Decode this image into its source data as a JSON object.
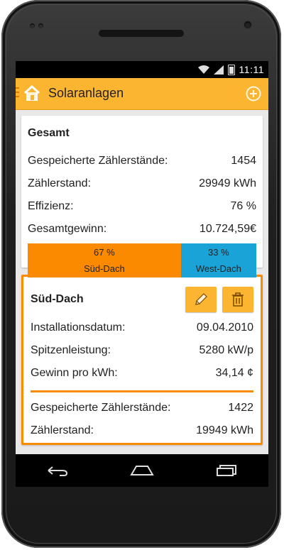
{
  "status": {
    "time": "11:11"
  },
  "app": {
    "title": "Solaranlagen"
  },
  "gesamt": {
    "title": "Gesamt",
    "rows": [
      {
        "label": "Gespeicherte Zählerstände:",
        "value": "1454"
      },
      {
        "label": "Zählerstand:",
        "value": "29949 kWh"
      },
      {
        "label": "Effizienz:",
        "value": "76 %"
      },
      {
        "label": "Gesamtgewinn:",
        "value": "10.724,59€"
      }
    ],
    "distribution": [
      {
        "percent": "67 %",
        "name": "Süd-Dach",
        "color": "#fb8a00",
        "fraction": 0.67
      },
      {
        "percent": "33 %",
        "name": "West-Dach",
        "color": "#1aa3d6",
        "fraction": 0.33
      }
    ]
  },
  "sued": {
    "title": "Süd-Dach",
    "edit_icon": "pencil-icon",
    "delete_icon": "trash-icon",
    "rows": [
      {
        "label": "Installationsdatum:",
        "value": "09.04.2010"
      },
      {
        "label": "Spitzenleistung:",
        "value": "5280 kW/p"
      },
      {
        "label": "Gewinn pro kWh:",
        "value": "34,14 ¢"
      }
    ],
    "rows2": [
      {
        "label": "Gespeicherte Zählerstände:",
        "value": "1422"
      },
      {
        "label": "Zählerstand:",
        "value": "19949 kWh"
      }
    ]
  },
  "colors": {
    "accent": "#fbb531",
    "orange": "#fb8a00",
    "blue": "#1aa3d6"
  }
}
